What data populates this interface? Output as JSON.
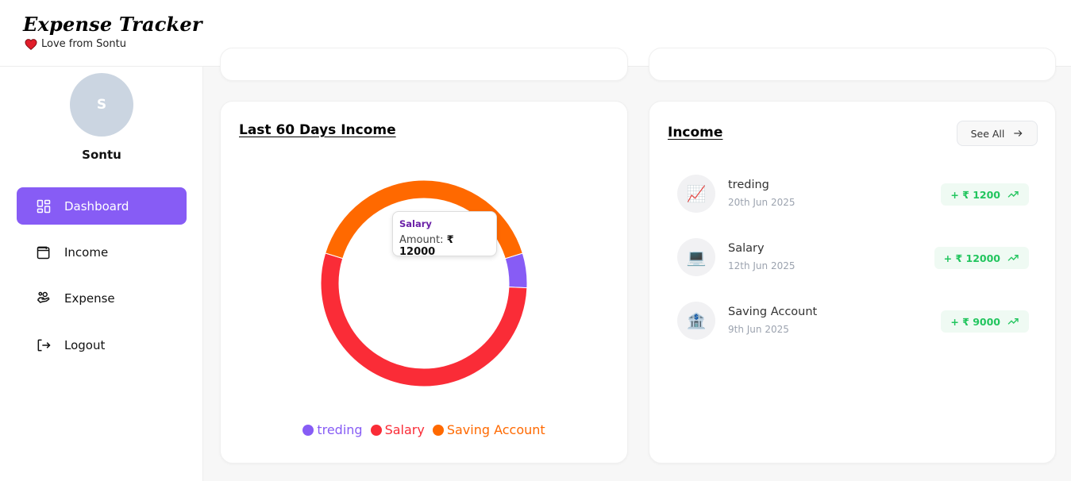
{
  "app": {
    "title": "Expense Tracker",
    "tagline": "Love from Sontu"
  },
  "user": {
    "initial": "S",
    "name": "Sontu"
  },
  "sidebar": {
    "items": [
      {
        "label": "Dashboard",
        "icon": "dashboard-icon",
        "active": true
      },
      {
        "label": "Income",
        "icon": "wallet-icon",
        "active": false
      },
      {
        "label": "Expense",
        "icon": "hand-coins-icon",
        "active": false
      },
      {
        "label": "Logout",
        "icon": "logout-icon",
        "active": false
      }
    ]
  },
  "colors": {
    "accent": "#875cf5",
    "treding": "#875cf5",
    "salary": "#fa2c37",
    "saving": "#ff6900",
    "positive": "#22c55e"
  },
  "income_chart": {
    "title": "Last 60 Days Income",
    "tooltip": {
      "name": "Salary",
      "amount_label": "Amount:",
      "amount_value": "₹ 12000"
    }
  },
  "chart_data": {
    "type": "pie",
    "title": "Last 60 Days Income",
    "categories": [
      "treding",
      "Salary",
      "Saving Account"
    ],
    "values": [
      1200,
      12000,
      9000
    ],
    "colors": [
      "#875cf5",
      "#fa2c37",
      "#ff6900"
    ],
    "legend": "bottom"
  },
  "income_list": {
    "title": "Income",
    "see_all_label": "See All",
    "items": [
      {
        "name": "treding",
        "date": "20th Jun 2025",
        "amount": "+ ₹ 1200",
        "emoji": "📈"
      },
      {
        "name": "Salary",
        "date": "12th Jun 2025",
        "amount": "+ ₹ 12000",
        "emoji": "💻"
      },
      {
        "name": "Saving Account",
        "date": "9th Jun 2025",
        "amount": "+ ₹ 9000",
        "emoji": "🏦"
      }
    ]
  }
}
